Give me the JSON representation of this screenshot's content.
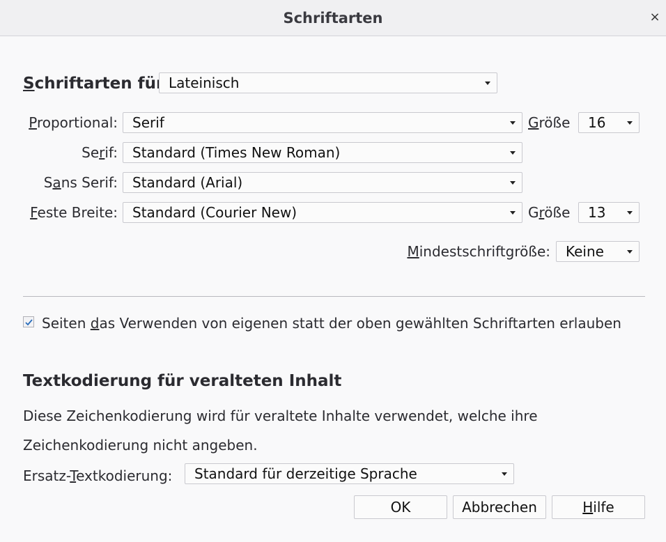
{
  "window": {
    "title": "Schriftarten",
    "close_glyph": "×"
  },
  "fonts_for": {
    "label_u": "S",
    "label_rest": "chriftarten für",
    "value": "Lateinisch"
  },
  "proportional": {
    "label_u": "P",
    "label_rest": "roportional:",
    "value": "Serif",
    "size_label_pre": "",
    "size_label_u": "G",
    "size_label_rest": "röße",
    "size_value": "16"
  },
  "serif": {
    "label_pre": "Se",
    "label_u": "r",
    "label_rest": "if:",
    "value": "Standard (Times New Roman)"
  },
  "sans_serif": {
    "label_pre": "S",
    "label_u": "a",
    "label_rest": "ns Serif:",
    "value": "Standard (Arial)"
  },
  "monospace": {
    "label_u": "F",
    "label_rest": "este Breite:",
    "value": "Standard (Courier New)",
    "size_label_pre": "G",
    "size_label_u": "r",
    "size_label_rest": "öße",
    "size_value": "13"
  },
  "min_size": {
    "label_u": "M",
    "label_rest": "indestschriftgröße:",
    "value": "Keine"
  },
  "allow_page_fonts": {
    "checked": true,
    "label_pre": "Seiten ",
    "label_u": "d",
    "label_rest": "as Verwenden von eigenen statt der oben gewählten Schriftarten erlauben"
  },
  "encoding": {
    "heading": "Textkodierung für veralteten Inhalt",
    "description_line1": "Diese Zeichenkodierung wird für veraltete Inhalte verwendet, welche ihre",
    "description_line2": "Zeichenkodierung nicht angeben.",
    "fallback_label_pre": "Ersatz-",
    "fallback_label_u": "T",
    "fallback_label_rest": "extkodierung:",
    "fallback_value": "Standard für derzeitige Sprache"
  },
  "buttons": {
    "ok": "OK",
    "cancel": "Abbrechen",
    "help_u": "H",
    "help_rest": "ilfe"
  },
  "colors": {
    "window_bg": "#f9f9fa",
    "titlebar_bg": "#f0f0f2",
    "check_mark": "#2a6ebb"
  }
}
